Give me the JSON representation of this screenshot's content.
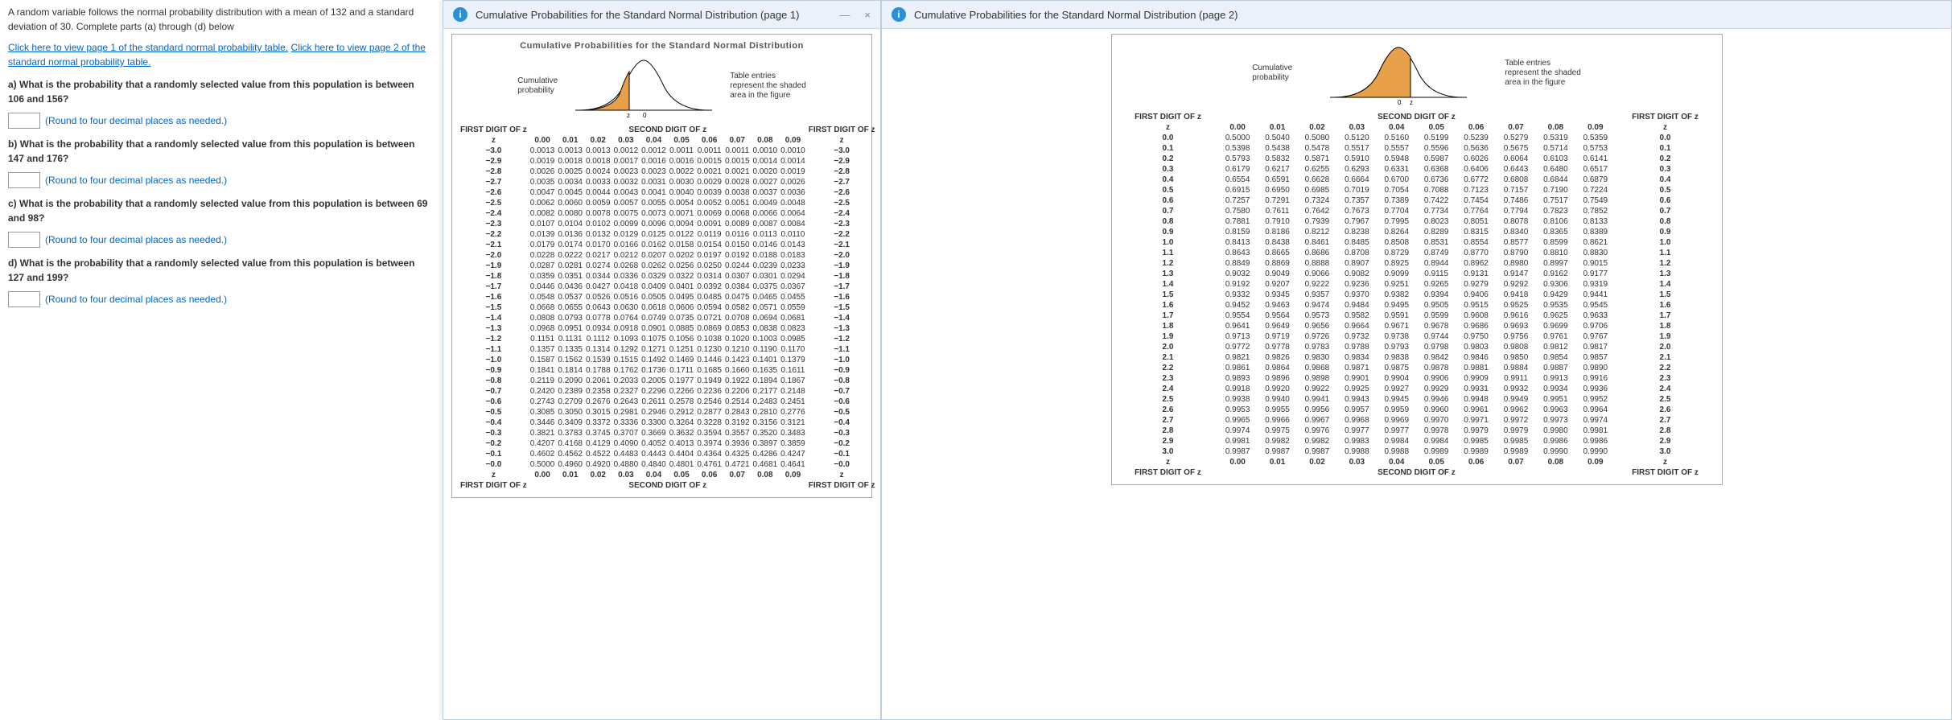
{
  "problem": {
    "intro": "A random variable follows the normal probability distribution with a mean of 132 and a standard deviation of 30. Complete parts (a) through (d) below",
    "link1": "Click here to view page 1 of the standard normal probability table.",
    "link2": "Click here to view page 2 of the standard normal probability table.",
    "a": "a) What is the probability that a randomly selected value from this population is between 106 and 156?",
    "b": "b) What is the probability that a randomly selected value from this population is between 147 and 176?",
    "c": "c) What is the probability that a randomly selected value from this population is between 69 and 98?",
    "d": "d) What is the probability that a randomly selected value from this population is between 127 and 199?",
    "round": "(Round to four decimal places as needed.)"
  },
  "popup1": {
    "title": "Cumulative Probabilities for the Standard Normal Distribution (page 1)",
    "caption": "Cumulative Probabilities for the Standard Normal Distribution",
    "curve_left": "Cumulative\nprobability",
    "curve_right": "Table entries\nrepresent the shaded\narea in the figure",
    "first_digit": "FIRST DIGIT OF z",
    "second_digit": "SECOND DIGIT OF z",
    "z": "z",
    "cols": [
      "0.00",
      "0.01",
      "0.02",
      "0.03",
      "0.04",
      "0.05",
      "0.06",
      "0.07",
      "0.08",
      "0.09"
    ]
  },
  "popup2": {
    "title": "Cumulative Probabilities for the Standard Normal Distribution (page 2)",
    "curve_left": "Cumulative\nprobability",
    "curve_right": "Table entries\nrepresent the shaded\narea in the figure",
    "first_digit": "FIRST DIGIT OF z",
    "second_digit": "SECOND DIGIT OF z",
    "z": "z",
    "cols": [
      "0.00",
      "0.01",
      "0.02",
      "0.03",
      "0.04",
      "0.05",
      "0.06",
      "0.07",
      "0.08",
      "0.09"
    ]
  },
  "chart_data": [
    {
      "type": "table",
      "title": "Cumulative Probabilities for the Standard Normal Distribution (page 1)",
      "columns": [
        "z",
        "0.00",
        "0.01",
        "0.02",
        "0.03",
        "0.04",
        "0.05",
        "0.06",
        "0.07",
        "0.08",
        "0.09"
      ],
      "rows": [
        [
          "−3.0",
          "0.0013",
          "0.0013",
          "0.0013",
          "0.0012",
          "0.0012",
          "0.0011",
          "0.0011",
          "0.0011",
          "0.0010",
          "0.0010"
        ],
        [
          "−2.9",
          "0.0019",
          "0.0018",
          "0.0018",
          "0.0017",
          "0.0016",
          "0.0016",
          "0.0015",
          "0.0015",
          "0.0014",
          "0.0014"
        ],
        [
          "−2.8",
          "0.0026",
          "0.0025",
          "0.0024",
          "0.0023",
          "0.0023",
          "0.0022",
          "0.0021",
          "0.0021",
          "0.0020",
          "0.0019"
        ],
        [
          "−2.7",
          "0.0035",
          "0.0034",
          "0.0033",
          "0.0032",
          "0.0031",
          "0.0030",
          "0.0029",
          "0.0028",
          "0.0027",
          "0.0026"
        ],
        [
          "−2.6",
          "0.0047",
          "0.0045",
          "0.0044",
          "0.0043",
          "0.0041",
          "0.0040",
          "0.0039",
          "0.0038",
          "0.0037",
          "0.0036"
        ],
        [
          "−2.5",
          "0.0062",
          "0.0060",
          "0.0059",
          "0.0057",
          "0.0055",
          "0.0054",
          "0.0052",
          "0.0051",
          "0.0049",
          "0.0048"
        ],
        [
          "−2.4",
          "0.0082",
          "0.0080",
          "0.0078",
          "0.0075",
          "0.0073",
          "0.0071",
          "0.0069",
          "0.0068",
          "0.0066",
          "0.0064"
        ],
        [
          "−2.3",
          "0.0107",
          "0.0104",
          "0.0102",
          "0.0099",
          "0.0096",
          "0.0094",
          "0.0091",
          "0.0089",
          "0.0087",
          "0.0084"
        ],
        [
          "−2.2",
          "0.0139",
          "0.0136",
          "0.0132",
          "0.0129",
          "0.0125",
          "0.0122",
          "0.0119",
          "0.0116",
          "0.0113",
          "0.0110"
        ],
        [
          "−2.1",
          "0.0179",
          "0.0174",
          "0.0170",
          "0.0166",
          "0.0162",
          "0.0158",
          "0.0154",
          "0.0150",
          "0.0146",
          "0.0143"
        ],
        [
          "−2.0",
          "0.0228",
          "0.0222",
          "0.0217",
          "0.0212",
          "0.0207",
          "0.0202",
          "0.0197",
          "0.0192",
          "0.0188",
          "0.0183"
        ],
        [
          "−1.9",
          "0.0287",
          "0.0281",
          "0.0274",
          "0.0268",
          "0.0262",
          "0.0256",
          "0.0250",
          "0.0244",
          "0.0239",
          "0.0233"
        ],
        [
          "−1.8",
          "0.0359",
          "0.0351",
          "0.0344",
          "0.0336",
          "0.0329",
          "0.0322",
          "0.0314",
          "0.0307",
          "0.0301",
          "0.0294"
        ],
        [
          "−1.7",
          "0.0446",
          "0.0436",
          "0.0427",
          "0.0418",
          "0.0409",
          "0.0401",
          "0.0392",
          "0.0384",
          "0.0375",
          "0.0367"
        ],
        [
          "−1.6",
          "0.0548",
          "0.0537",
          "0.0526",
          "0.0516",
          "0.0505",
          "0.0495",
          "0.0485",
          "0.0475",
          "0.0465",
          "0.0455"
        ],
        [
          "−1.5",
          "0.0668",
          "0.0655",
          "0.0643",
          "0.0630",
          "0.0618",
          "0.0606",
          "0.0594",
          "0.0582",
          "0.0571",
          "0.0559"
        ],
        [
          "−1.4",
          "0.0808",
          "0.0793",
          "0.0778",
          "0.0764",
          "0.0749",
          "0.0735",
          "0.0721",
          "0.0708",
          "0.0694",
          "0.0681"
        ],
        [
          "−1.3",
          "0.0968",
          "0.0951",
          "0.0934",
          "0.0918",
          "0.0901",
          "0.0885",
          "0.0869",
          "0.0853",
          "0.0838",
          "0.0823"
        ],
        [
          "−1.2",
          "0.1151",
          "0.1131",
          "0.1112",
          "0.1093",
          "0.1075",
          "0.1056",
          "0.1038",
          "0.1020",
          "0.1003",
          "0.0985"
        ],
        [
          "−1.1",
          "0.1357",
          "0.1335",
          "0.1314",
          "0.1292",
          "0.1271",
          "0.1251",
          "0.1230",
          "0.1210",
          "0.1190",
          "0.1170"
        ],
        [
          "−1.0",
          "0.1587",
          "0.1562",
          "0.1539",
          "0.1515",
          "0.1492",
          "0.1469",
          "0.1446",
          "0.1423",
          "0.1401",
          "0.1379"
        ],
        [
          "−0.9",
          "0.1841",
          "0.1814",
          "0.1788",
          "0.1762",
          "0.1736",
          "0.1711",
          "0.1685",
          "0.1660",
          "0.1635",
          "0.1611"
        ],
        [
          "−0.8",
          "0.2119",
          "0.2090",
          "0.2061",
          "0.2033",
          "0.2005",
          "0.1977",
          "0.1949",
          "0.1922",
          "0.1894",
          "0.1867"
        ],
        [
          "−0.7",
          "0.2420",
          "0.2389",
          "0.2358",
          "0.2327",
          "0.2296",
          "0.2266",
          "0.2236",
          "0.2206",
          "0.2177",
          "0.2148"
        ],
        [
          "−0.6",
          "0.2743",
          "0.2709",
          "0.2676",
          "0.2643",
          "0.2611",
          "0.2578",
          "0.2546",
          "0.2514",
          "0.2483",
          "0.2451"
        ],
        [
          "−0.5",
          "0.3085",
          "0.3050",
          "0.3015",
          "0.2981",
          "0.2946",
          "0.2912",
          "0.2877",
          "0.2843",
          "0.2810",
          "0.2776"
        ],
        [
          "−0.4",
          "0.3446",
          "0.3409",
          "0.3372",
          "0.3336",
          "0.3300",
          "0.3264",
          "0.3228",
          "0.3192",
          "0.3156",
          "0.3121"
        ],
        [
          "−0.3",
          "0.3821",
          "0.3783",
          "0.3745",
          "0.3707",
          "0.3669",
          "0.3632",
          "0.3594",
          "0.3557",
          "0.3520",
          "0.3483"
        ],
        [
          "−0.2",
          "0.4207",
          "0.4168",
          "0.4129",
          "0.4090",
          "0.4052",
          "0.4013",
          "0.3974",
          "0.3936",
          "0.3897",
          "0.3859"
        ],
        [
          "−0.1",
          "0.4602",
          "0.4562",
          "0.4522",
          "0.4483",
          "0.4443",
          "0.4404",
          "0.4364",
          "0.4325",
          "0.4286",
          "0.4247"
        ],
        [
          "−0.0",
          "0.5000",
          "0.4960",
          "0.4920",
          "0.4880",
          "0.4840",
          "0.4801",
          "0.4761",
          "0.4721",
          "0.4681",
          "0.4641"
        ]
      ]
    },
    {
      "type": "table",
      "title": "Cumulative Probabilities for the Standard Normal Distribution (page 2)",
      "columns": [
        "z",
        "0.00",
        "0.01",
        "0.02",
        "0.03",
        "0.04",
        "0.05",
        "0.06",
        "0.07",
        "0.08",
        "0.09"
      ],
      "rows": [
        [
          "0.0",
          "0.5000",
          "0.5040",
          "0.5080",
          "0.5120",
          "0.5160",
          "0.5199",
          "0.5239",
          "0.5279",
          "0.5319",
          "0.5359"
        ],
        [
          "0.1",
          "0.5398",
          "0.5438",
          "0.5478",
          "0.5517",
          "0.5557",
          "0.5596",
          "0.5636",
          "0.5675",
          "0.5714",
          "0.5753"
        ],
        [
          "0.2",
          "0.5793",
          "0.5832",
          "0.5871",
          "0.5910",
          "0.5948",
          "0.5987",
          "0.6026",
          "0.6064",
          "0.6103",
          "0.6141"
        ],
        [
          "0.3",
          "0.6179",
          "0.6217",
          "0.6255",
          "0.6293",
          "0.6331",
          "0.6368",
          "0.6406",
          "0.6443",
          "0.6480",
          "0.6517"
        ],
        [
          "0.4",
          "0.6554",
          "0.6591",
          "0.6628",
          "0.6664",
          "0.6700",
          "0.6736",
          "0.6772",
          "0.6808",
          "0.6844",
          "0.6879"
        ],
        [
          "0.5",
          "0.6915",
          "0.6950",
          "0.6985",
          "0.7019",
          "0.7054",
          "0.7088",
          "0.7123",
          "0.7157",
          "0.7190",
          "0.7224"
        ],
        [
          "0.6",
          "0.7257",
          "0.7291",
          "0.7324",
          "0.7357",
          "0.7389",
          "0.7422",
          "0.7454",
          "0.7486",
          "0.7517",
          "0.7549"
        ],
        [
          "0.7",
          "0.7580",
          "0.7611",
          "0.7642",
          "0.7673",
          "0.7704",
          "0.7734",
          "0.7764",
          "0.7794",
          "0.7823",
          "0.7852"
        ],
        [
          "0.8",
          "0.7881",
          "0.7910",
          "0.7939",
          "0.7967",
          "0.7995",
          "0.8023",
          "0.8051",
          "0.8078",
          "0.8106",
          "0.8133"
        ],
        [
          "0.9",
          "0.8159",
          "0.8186",
          "0.8212",
          "0.8238",
          "0.8264",
          "0.8289",
          "0.8315",
          "0.8340",
          "0.8365",
          "0.8389"
        ],
        [
          "1.0",
          "0.8413",
          "0.8438",
          "0.8461",
          "0.8485",
          "0.8508",
          "0.8531",
          "0.8554",
          "0.8577",
          "0.8599",
          "0.8621"
        ],
        [
          "1.1",
          "0.8643",
          "0.8665",
          "0.8686",
          "0.8708",
          "0.8729",
          "0.8749",
          "0.8770",
          "0.8790",
          "0.8810",
          "0.8830"
        ],
        [
          "1.2",
          "0.8849",
          "0.8869",
          "0.8888",
          "0.8907",
          "0.8925",
          "0.8944",
          "0.8962",
          "0.8980",
          "0.8997",
          "0.9015"
        ],
        [
          "1.3",
          "0.9032",
          "0.9049",
          "0.9066",
          "0.9082",
          "0.9099",
          "0.9115",
          "0.9131",
          "0.9147",
          "0.9162",
          "0.9177"
        ],
        [
          "1.4",
          "0.9192",
          "0.9207",
          "0.9222",
          "0.9236",
          "0.9251",
          "0.9265",
          "0.9279",
          "0.9292",
          "0.9306",
          "0.9319"
        ],
        [
          "1.5",
          "0.9332",
          "0.9345",
          "0.9357",
          "0.9370",
          "0.9382",
          "0.9394",
          "0.9406",
          "0.9418",
          "0.9429",
          "0.9441"
        ],
        [
          "1.6",
          "0.9452",
          "0.9463",
          "0.9474",
          "0.9484",
          "0.9495",
          "0.9505",
          "0.9515",
          "0.9525",
          "0.9535",
          "0.9545"
        ],
        [
          "1.7",
          "0.9554",
          "0.9564",
          "0.9573",
          "0.9582",
          "0.9591",
          "0.9599",
          "0.9608",
          "0.9616",
          "0.9625",
          "0.9633"
        ],
        [
          "1.8",
          "0.9641",
          "0.9649",
          "0.9656",
          "0.9664",
          "0.9671",
          "0.9678",
          "0.9686",
          "0.9693",
          "0.9699",
          "0.9706"
        ],
        [
          "1.9",
          "0.9713",
          "0.9719",
          "0.9726",
          "0.9732",
          "0.9738",
          "0.9744",
          "0.9750",
          "0.9756",
          "0.9761",
          "0.9767"
        ],
        [
          "2.0",
          "0.9772",
          "0.9778",
          "0.9783",
          "0.9788",
          "0.9793",
          "0.9798",
          "0.9803",
          "0.9808",
          "0.9812",
          "0.9817"
        ],
        [
          "2.1",
          "0.9821",
          "0.9826",
          "0.9830",
          "0.9834",
          "0.9838",
          "0.9842",
          "0.9846",
          "0.9850",
          "0.9854",
          "0.9857"
        ],
        [
          "2.2",
          "0.9861",
          "0.9864",
          "0.9868",
          "0.9871",
          "0.9875",
          "0.9878",
          "0.9881",
          "0.9884",
          "0.9887",
          "0.9890"
        ],
        [
          "2.3",
          "0.9893",
          "0.9896",
          "0.9898",
          "0.9901",
          "0.9904",
          "0.9906",
          "0.9909",
          "0.9911",
          "0.9913",
          "0.9916"
        ],
        [
          "2.4",
          "0.9918",
          "0.9920",
          "0.9922",
          "0.9925",
          "0.9927",
          "0.9929",
          "0.9931",
          "0.9932",
          "0.9934",
          "0.9936"
        ],
        [
          "2.5",
          "0.9938",
          "0.9940",
          "0.9941",
          "0.9943",
          "0.9945",
          "0.9946",
          "0.9948",
          "0.9949",
          "0.9951",
          "0.9952"
        ],
        [
          "2.6",
          "0.9953",
          "0.9955",
          "0.9956",
          "0.9957",
          "0.9959",
          "0.9960",
          "0.9961",
          "0.9962",
          "0.9963",
          "0.9964"
        ],
        [
          "2.7",
          "0.9965",
          "0.9966",
          "0.9967",
          "0.9968",
          "0.9969",
          "0.9970",
          "0.9971",
          "0.9972",
          "0.9973",
          "0.9974"
        ],
        [
          "2.8",
          "0.9974",
          "0.9975",
          "0.9976",
          "0.9977",
          "0.9977",
          "0.9978",
          "0.9979",
          "0.9979",
          "0.9980",
          "0.9981"
        ],
        [
          "2.9",
          "0.9981",
          "0.9982",
          "0.9982",
          "0.9983",
          "0.9984",
          "0.9984",
          "0.9985",
          "0.9985",
          "0.9986",
          "0.9986"
        ],
        [
          "3.0",
          "0.9987",
          "0.9987",
          "0.9987",
          "0.9988",
          "0.9988",
          "0.9989",
          "0.9989",
          "0.9989",
          "0.9990",
          "0.9990"
        ]
      ]
    }
  ]
}
